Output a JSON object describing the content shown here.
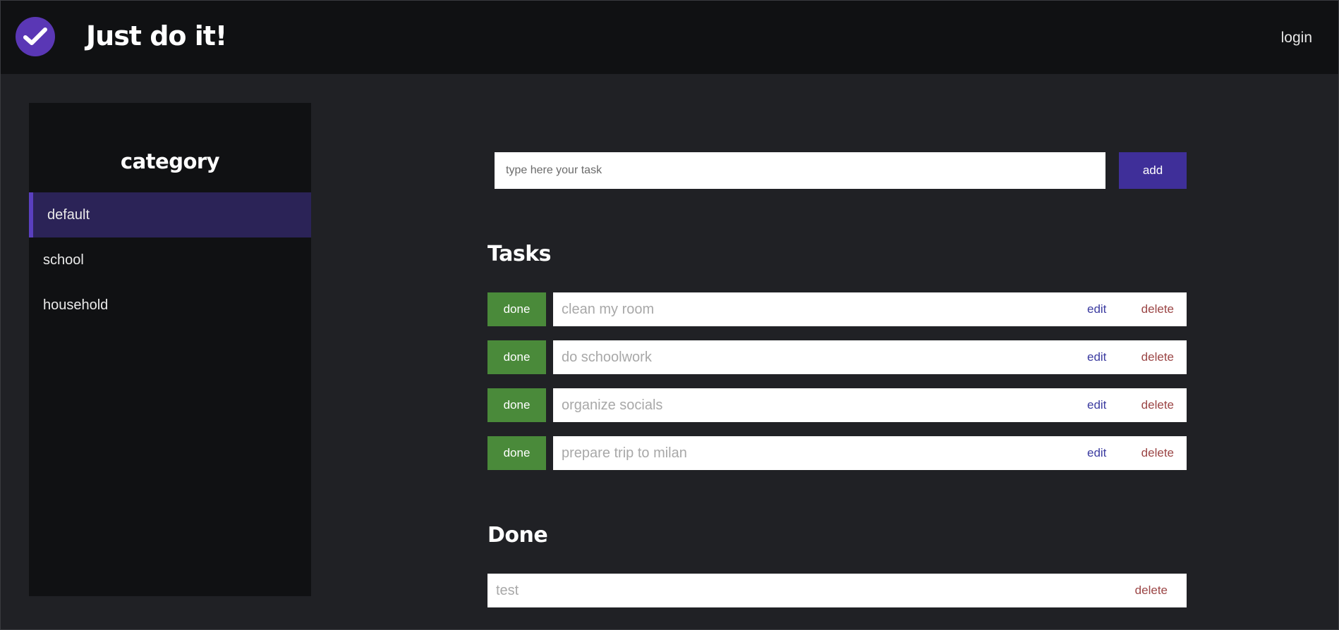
{
  "header": {
    "logo_icon": "check-circle-icon",
    "title": "Just do it!",
    "login_label": "login"
  },
  "sidebar": {
    "title": "category",
    "items": [
      {
        "label": "default",
        "active": true
      },
      {
        "label": "school",
        "active": false
      },
      {
        "label": "household",
        "active": false
      }
    ]
  },
  "add_task": {
    "placeholder": "type here your task",
    "button_label": "add"
  },
  "tasks": {
    "title": "Tasks",
    "items": [
      {
        "text": "clean my room",
        "done_label": "done",
        "edit_label": "edit",
        "delete_label": "delete"
      },
      {
        "text": "do schoolwork",
        "done_label": "done",
        "edit_label": "edit",
        "delete_label": "delete"
      },
      {
        "text": "organize socials",
        "done_label": "done",
        "edit_label": "edit",
        "delete_label": "delete"
      },
      {
        "text": "prepare trip to milan",
        "done_label": "done",
        "edit_label": "edit",
        "delete_label": "delete"
      }
    ]
  },
  "done": {
    "title": "Done",
    "items": [
      {
        "text": "test",
        "delete_label": "delete"
      }
    ]
  },
  "colors": {
    "accent": "#5a37b5",
    "add_button": "#3f2f99",
    "done_button": "#4a8a3a",
    "active_category": "#2b2357",
    "background": "#202125",
    "panel": "#101113"
  }
}
